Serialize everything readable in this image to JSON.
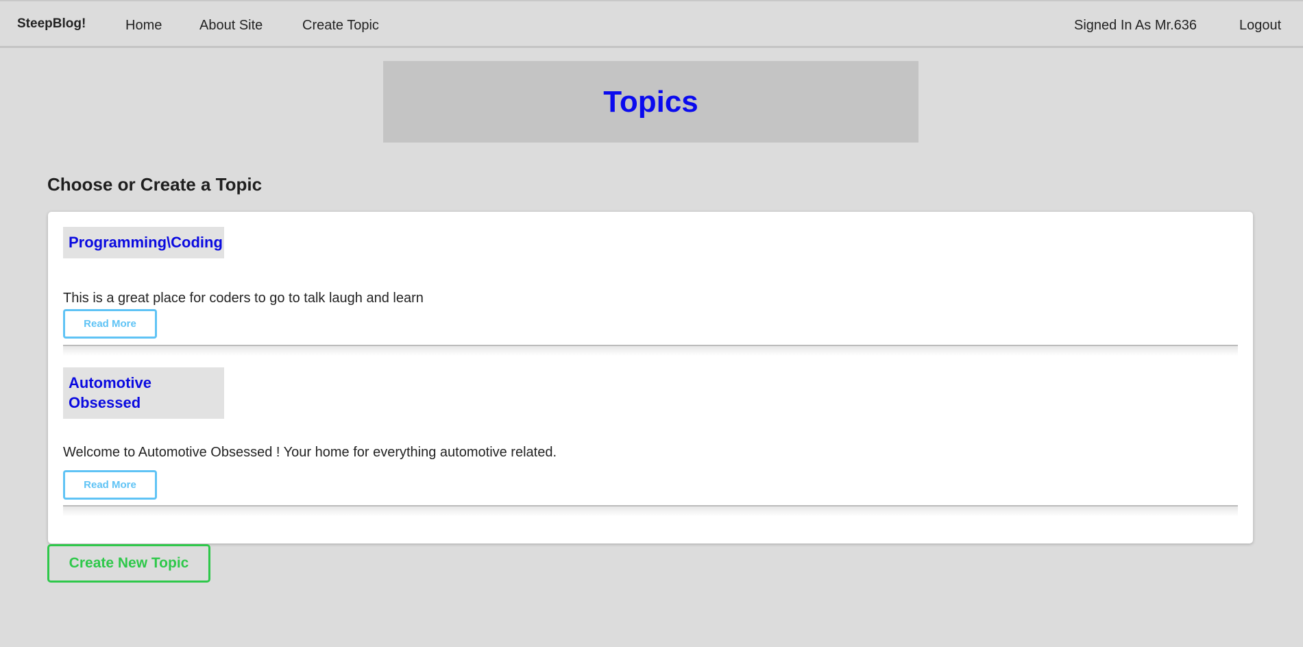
{
  "nav": {
    "brand": "SteepBlog!",
    "home": "Home",
    "about": "About Site",
    "create_topic": "Create Topic",
    "signed_in": "Signed In As Mr.636",
    "logout": "Logout"
  },
  "banner": {
    "title": "Topics"
  },
  "heading": "Choose or Create a Topic",
  "topics": [
    {
      "title": "Programming\\Coding",
      "description": "This is a great place for coders to go to talk laugh and learn",
      "button": "Read More"
    },
    {
      "title": "Automotive Obsessed",
      "description": "Welcome to Automotive Obsessed ! Your home for everything automotive related.",
      "button": "Read More"
    }
  ],
  "create_button": "Create New Topic",
  "colors": {
    "accent_blue": "#0a0aee",
    "read_more": "#5fc3f5",
    "create": "#2ec84a"
  }
}
